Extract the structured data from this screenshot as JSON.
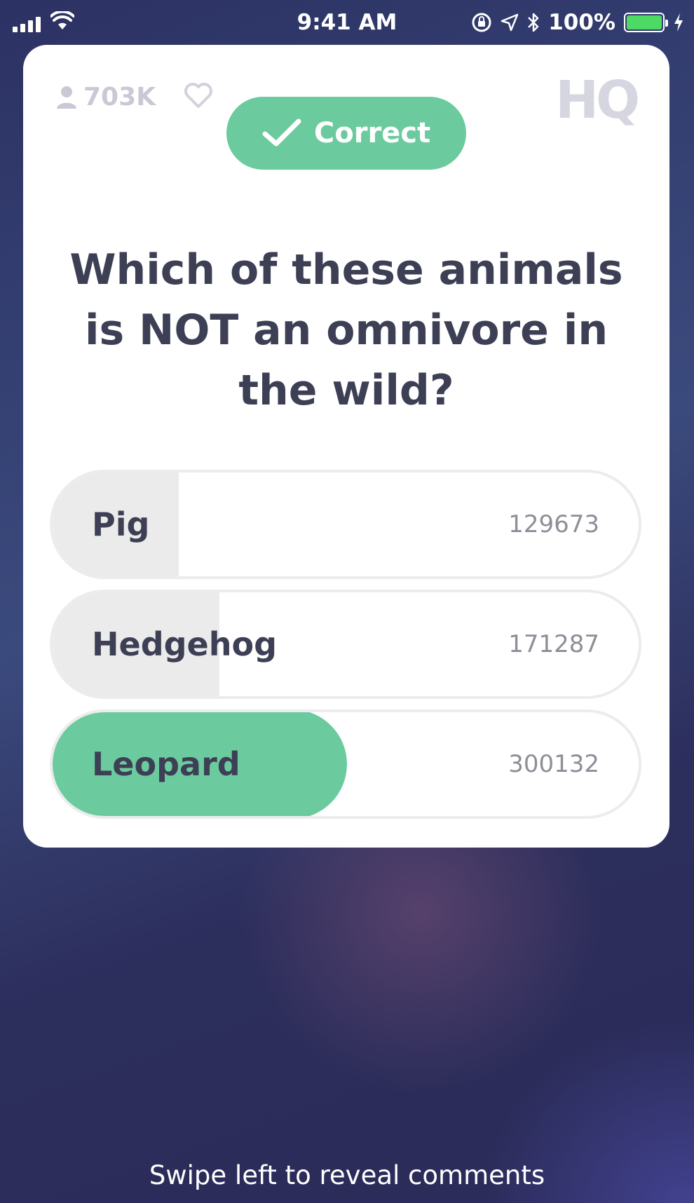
{
  "status_bar": {
    "time": "9:41 AM",
    "battery_percent": "100%",
    "battery_level": 1.0,
    "icons": [
      "signal-icon",
      "wifi-icon",
      "orientation-lock-icon",
      "location-icon",
      "bluetooth-icon",
      "battery-icon",
      "charging-icon"
    ]
  },
  "header": {
    "viewer_count": "703K",
    "logo": "HQ",
    "result_label": "Correct"
  },
  "question": {
    "text": "Which of these animals is NOT an omnivore in the wild?"
  },
  "answers": [
    {
      "label": "Pig",
      "count": "129673",
      "correct": false
    },
    {
      "label": "Hedgehog",
      "count": "171287",
      "correct": false
    },
    {
      "label": "Leopard",
      "count": "300132",
      "correct": true
    }
  ],
  "footer": {
    "hint": "Swipe left to reveal comments"
  },
  "colors": {
    "correct_green": "#6bcb9e",
    "text_dark": "#3d3f55",
    "background_top": "#2c3263",
    "background_bottom": "#2b2b58"
  }
}
